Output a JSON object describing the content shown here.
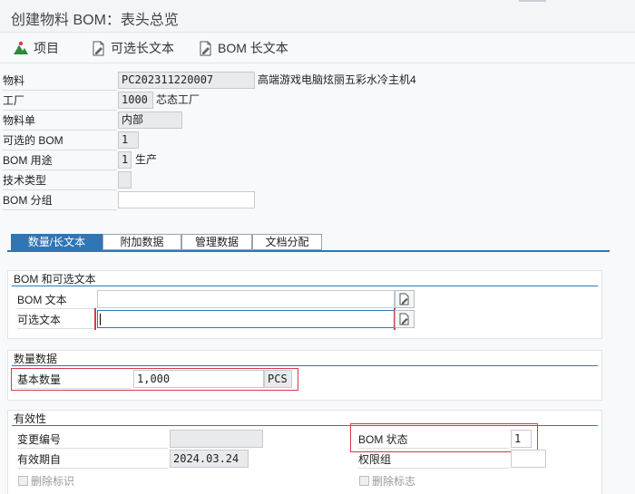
{
  "title": "创建物料 BOM：表头总览",
  "toolbar": {
    "items_label": "项目",
    "alt_long_text_label": "可选长文本",
    "bom_long_text_label": "BOM 长文本"
  },
  "header_fields": {
    "material_label": "物料",
    "material_value": "PC202311220007",
    "material_desc": "高端游戏电脑炫丽五彩水冷主机4",
    "plant_label": "工厂",
    "plant_value": "1000",
    "plant_desc": "芯态工厂",
    "material_list_label": "物料单",
    "material_list_value": "内部",
    "alt_bom_label": "可选的 BOM",
    "alt_bom_value": "1",
    "bom_usage_label": "BOM 用途",
    "bom_usage_value": "1",
    "bom_usage_desc": "生产",
    "tech_type_label": "技术类型",
    "tech_type_value": "",
    "bom_group_label": "BOM 分组",
    "bom_group_value": ""
  },
  "tabs": [
    "数量/长文本",
    "附加数据",
    "管理数据",
    "文档分配"
  ],
  "bom_text_group": {
    "title": "BOM 和可选文本",
    "bom_text_label": "BOM 文本",
    "bom_text_value": "",
    "alt_text_label": "可选文本",
    "alt_text_value": ""
  },
  "quantity_group": {
    "title": "数量数据",
    "base_qty_label": "基本数量",
    "base_qty_value": "1,000",
    "unit": "PCS"
  },
  "validity_group": {
    "title": "有效性",
    "change_no_label": "变更编号",
    "change_no_value": "",
    "valid_from_label": "有效期自",
    "valid_from_value": "2024.03.24",
    "deletion_flag_left": "删除标识",
    "bom_status_label": "BOM 状态",
    "bom_status_value": "1",
    "auth_group_label": "权限组",
    "auth_group_value": "",
    "deletion_flag_right": "删除标志"
  }
}
